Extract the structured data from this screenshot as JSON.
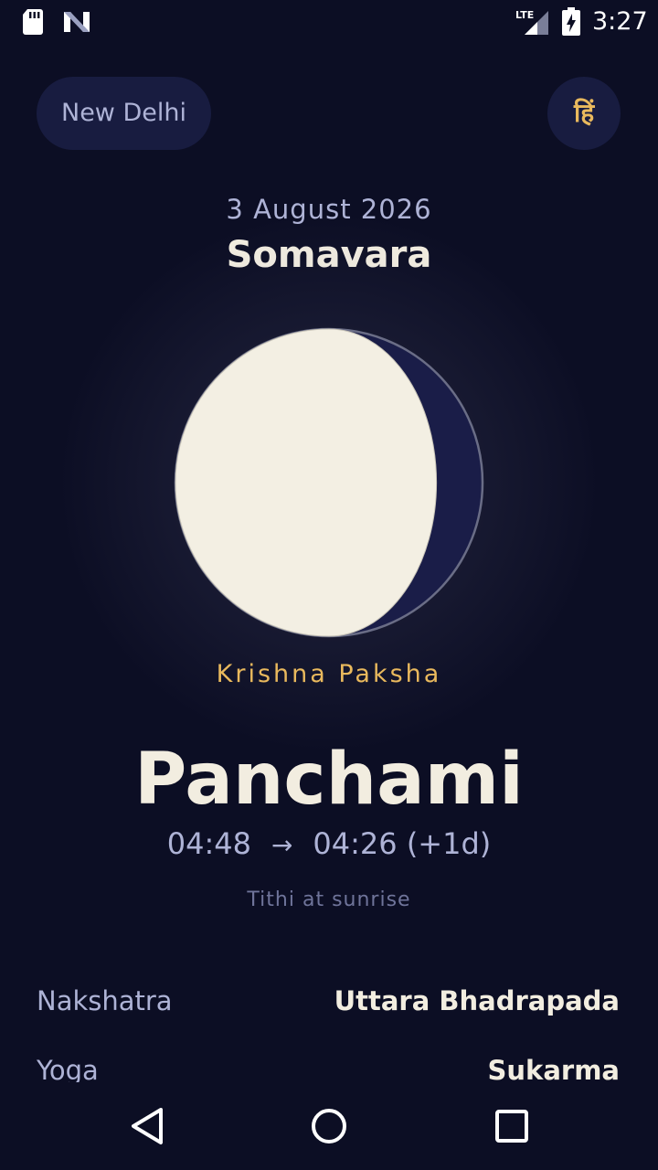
{
  "status_bar": {
    "time": "3:27",
    "network": "LTE",
    "icons": [
      "sd-card-icon",
      "n-icon",
      "lte-signal-icon",
      "battery-charging-icon"
    ]
  },
  "header": {
    "city": "New Delhi",
    "language_toggle": "हिं"
  },
  "date": {
    "full_date": "3 August 2026",
    "weekday": "Somavara"
  },
  "moon": {
    "paksha": "Krishna Paksha",
    "illuminated_fraction": 0.85,
    "phase": "waning"
  },
  "tithi": {
    "name": "Panchami",
    "start": "04:48",
    "arrow": "→",
    "end": "04:26 (+1d)",
    "note": "Tithi at sunrise"
  },
  "details": [
    {
      "label": "Nakshatra",
      "value": "Uttara Bhadrapada"
    },
    {
      "label": "Yoga",
      "value": "Sukarma"
    }
  ],
  "colors": {
    "background": "#0c0e24",
    "accent": "#e9b95d",
    "moon_lit": "#f3efe3",
    "moon_dark": "#1a1d48",
    "muted_text": "#aeb3d6"
  },
  "nav_bar": {
    "icons": [
      "back-icon",
      "home-icon",
      "recents-icon"
    ]
  }
}
